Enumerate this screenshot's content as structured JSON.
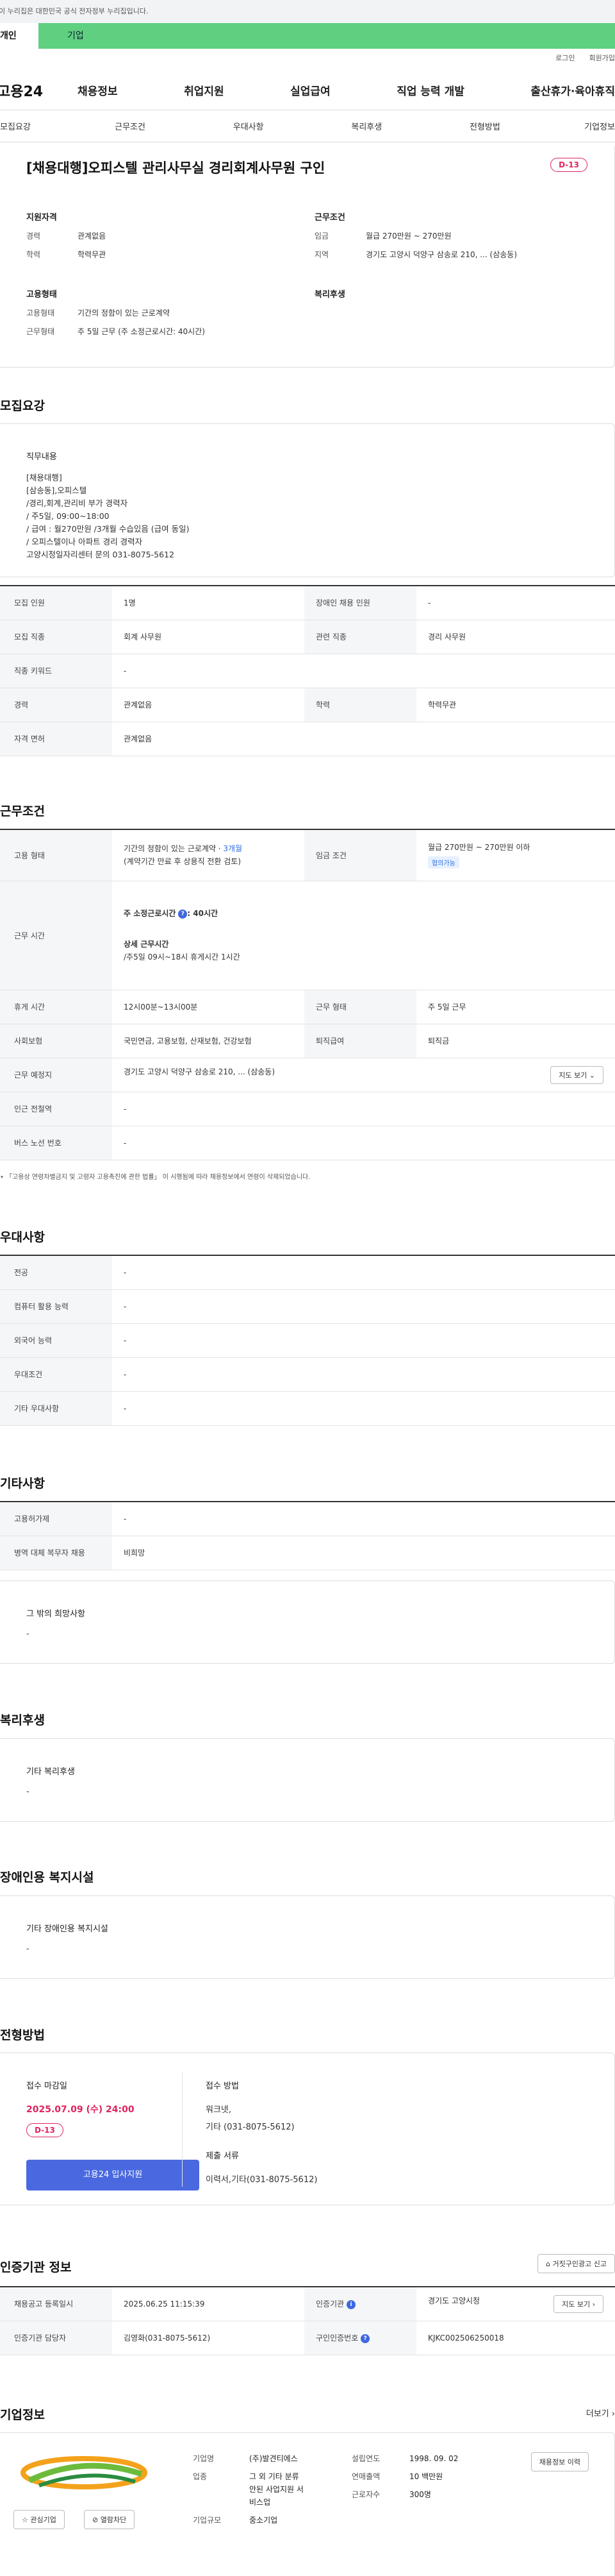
{
  "gov_notice": "이 누리집은 대한민국 공식 전자정부 누리집입니다.",
  "top_tabs": {
    "personal": "개인",
    "company": "기업"
  },
  "util": {
    "login": "로그인",
    "signup": "회원가입"
  },
  "logo": "고용24",
  "gnb": [
    "채용정보",
    "취업지원",
    "실업급여",
    "직업 능력 개발",
    "출산휴가·육아휴직"
  ],
  "subnav": [
    "모집요강",
    "근무조건",
    "우대사항",
    "복리후생",
    "전형방법",
    "기업정보"
  ],
  "summary": {
    "title": "[채용대행]오피스텔 관리사무실 경리회계사무원 구인",
    "dday": "D-13",
    "qual_title": "지원자격",
    "career_label": "경력",
    "career": "관계없음",
    "edu_label": "학력",
    "edu": "학력무관",
    "cond_title": "근무조건",
    "wage_label": "임금",
    "wage": "월급 270만원 ~ 270만원",
    "region_label": "지역",
    "region": "경기도 고양시 덕양구 삼송로 210, ... (삼송동)",
    "emp_title": "고용형태",
    "emptype_label": "고용형태",
    "emptype": "기간의 정함이 있는 근로계약",
    "worktype_label": "근무형태",
    "worktype": "주 5일 근무 (주 소정근로시간: 40시간)",
    "welfare_title": "복리후생"
  },
  "recruit": {
    "heading": "모집요강",
    "duty_label": "직무내용",
    "duty_lines": [
      "[채용대행]",
      "[삼송동],오피스텔",
      "/경리,회계,관리비 부가 경력자",
      "/ 주5일, 09:00~18:00",
      "/ 급여 : 월270만원 /3개월 수습있음 (급여 동일)",
      "/ 오피스텔이나 아파트 경리 경력자",
      "고양시정일자리센터 문의 031-8075-5612"
    ],
    "rows": [
      {
        "k1": "모집 인원",
        "v1": "1명",
        "k2": "장애인 채용 인원",
        "v2": "-"
      },
      {
        "k1": "모집 직종",
        "v1": "회계 사무원",
        "k2": "관련 직종",
        "v2": "경리 사무원"
      },
      {
        "k1": "직종 키워드",
        "v1": "-"
      },
      {
        "k1": "경력",
        "v1": "관계없음",
        "k2": "학력",
        "v2": "학력무관"
      },
      {
        "k1": "자격 면허",
        "v1": "관계없음"
      }
    ]
  },
  "work": {
    "heading": "근무조건",
    "emptype_label": "고용 형태",
    "emptype_1": "기간의 정함이 있는 근로계약 · ",
    "emptype_months": "3개월",
    "emptype_2": "(계약기간 만료 후 상용직 전환 검토)",
    "wage_label": "임금 조건",
    "wage": "월급 270만원 ~ 270만원 이하",
    "wage_badge": "협의가능",
    "hours_label": "근무 시간",
    "hours_title": "주 소정근로시간",
    "hours_value": ": 40시간",
    "hours_detail_title": "상세 근무시간",
    "hours_detail": "/주5일 09시~18시 휴게시간 1시간",
    "break_label": "휴게 시간",
    "break": "12시00분~13시00분",
    "shift_label": "근무 형태",
    "shift": "주 5일 근무",
    "insurance_label": "사회보험",
    "insurance": "국민연금, 고용보험, 산재보험, 건강보험",
    "retire_label": "퇴직급여",
    "retire": "퇴직금",
    "place_label": "근무 예정지",
    "place": "경기도 고양시 덕양구 삼송로 210, ... (삼송동)",
    "map_btn": "지도 보기 ⌄",
    "station_label": "인근 전철역",
    "station": "-",
    "bus_label": "버스 노선 번호",
    "bus": "-",
    "note": "• 「고용상 연령차별금지 및 고령자 고용촉진에 관한 법률」 이 시행됨에 따라 채용정보에서 연령이 삭제되었습니다."
  },
  "pref": {
    "heading": "우대사항",
    "rows": [
      {
        "k": "전공",
        "v": "-"
      },
      {
        "k": "컴퓨터 활용 능력",
        "v": "-"
      },
      {
        "k": "외국어 능력",
        "v": "-"
      },
      {
        "k": "우대조건",
        "v": "-"
      },
      {
        "k": "기타 우대사항",
        "v": "-"
      }
    ]
  },
  "etc": {
    "heading": "기타사항",
    "rows": [
      {
        "k": "고용허가제",
        "v": "-"
      },
      {
        "k": "병역 대체 복무자 채용",
        "v": "비희망"
      }
    ],
    "hope_label": "그 밖의 희망사항",
    "hope": "-"
  },
  "welfare": {
    "heading": "복리후생",
    "label": "기타 복리후생",
    "value": "-"
  },
  "disability": {
    "heading": "장애인용 복지시설",
    "label": "기타 장애인용 복지시설",
    "value": "-"
  },
  "process": {
    "heading": "전형방법",
    "deadline_label": "접수 마감일",
    "deadline": "2025.07.09 (수) 24:00",
    "dday": "D-13",
    "apply_btn": "고용24 입사지원",
    "method_label": "접수 방법",
    "method_1": "워크넷,",
    "method_2": "기타 (031-8075-5612)",
    "docs_label": "제출 서류",
    "docs": "이력서,기타(031-8075-5612)"
  },
  "agency": {
    "heading": "인증기관 정보",
    "report_btn": "거짓구인광고 신고",
    "reg_date_label": "채용공고 등록일시",
    "reg_date": "2025.06.25 11:15:39",
    "agency_label": "인증기관",
    "agency": "경기도 고양시청",
    "map_btn": "지도 보기 ›",
    "manager_label": "인증기관 담당자",
    "manager": "김영화(031-8075-5612)",
    "job_no_label": "구인인증번호",
    "job_no": "KJKC002506250018"
  },
  "company": {
    "heading": "기업정보",
    "more": "더보기 ›",
    "name_label": "기업명",
    "name": "(주)발견티에스",
    "industry_label": "업종",
    "industry_lines": [
      "그 외 기타 분류",
      "안된 사업지원 서",
      "비스업"
    ],
    "scale_label": "기업규모",
    "scale": "중소기업",
    "founded_label": "설립연도",
    "founded": "1998. 09. 02",
    "revenue_label": "연매출액",
    "revenue": "10 백만원",
    "staff_label": "근로자수",
    "staff": "300명",
    "corp_btn": "채용정보 이력",
    "interest_btn": "☆ 관심기업",
    "block_btn": "⊘ 열람차단"
  }
}
